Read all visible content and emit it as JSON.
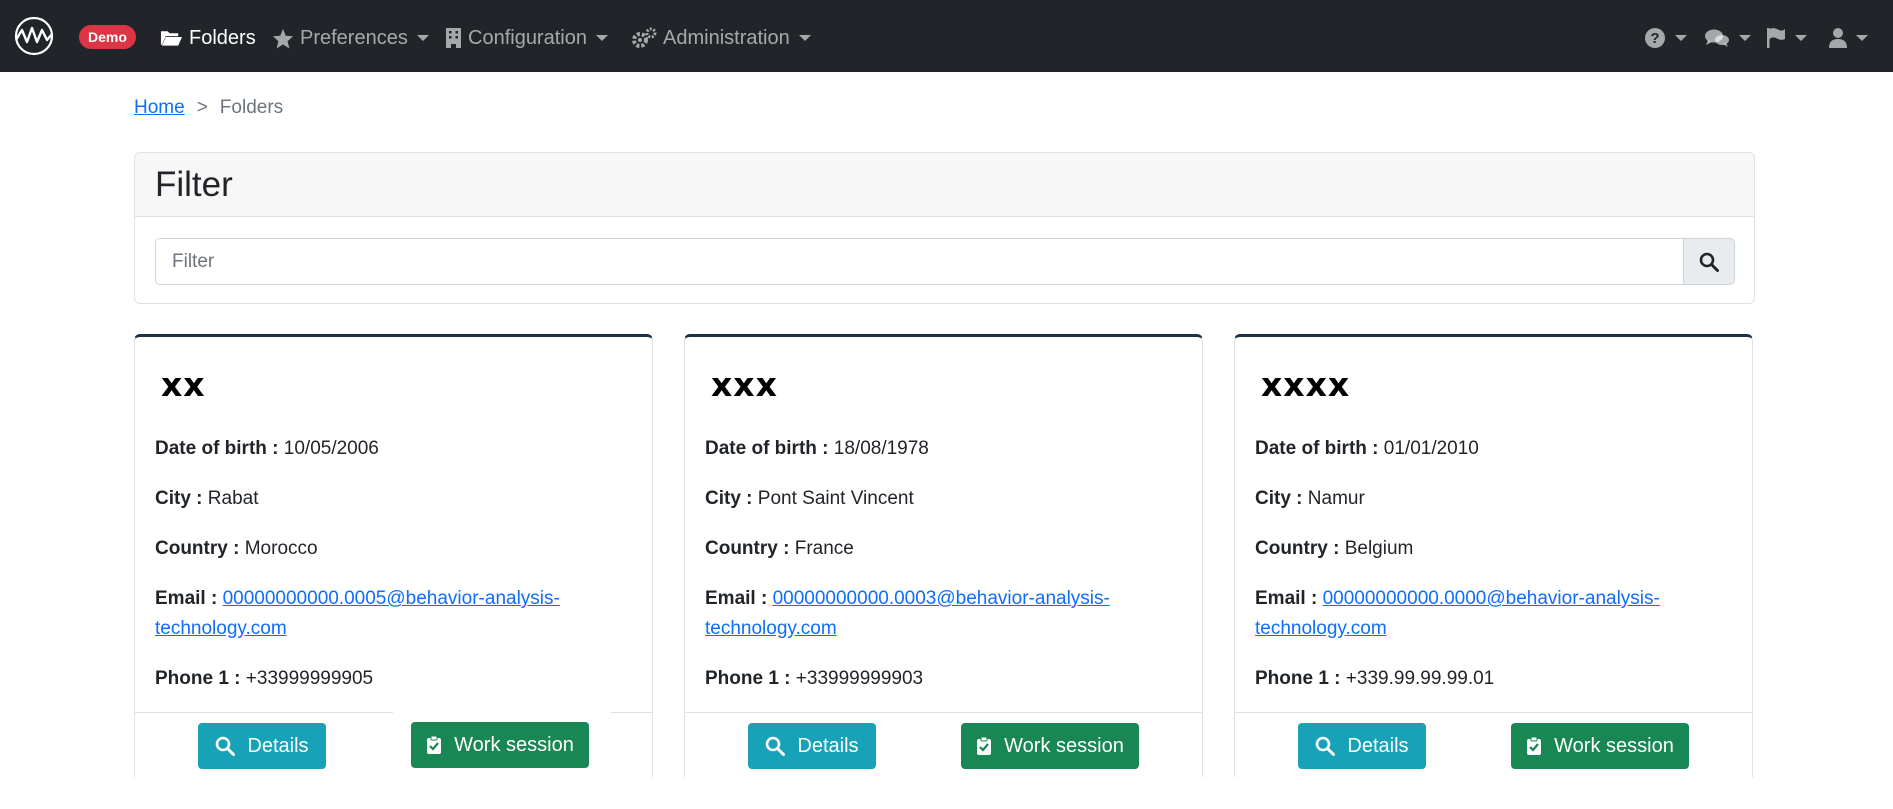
{
  "navbar": {
    "badge": "Demo",
    "items": [
      {
        "label": "Folders",
        "icon": "folder-open-icon"
      },
      {
        "label": "Preferences",
        "icon": "star-icon"
      },
      {
        "label": "Configuration",
        "icon": "building-icon"
      },
      {
        "label": "Administration",
        "icon": "gears-icon"
      }
    ],
    "right_icons": [
      "question-circle-icon",
      "comments-icon",
      "flag-icon",
      "user-icon"
    ]
  },
  "breadcrumb": {
    "home": "Home",
    "separator": ">",
    "current": "Folders"
  },
  "filter": {
    "title": "Filter",
    "placeholder": "Filter"
  },
  "labels": {
    "dob": "Date of birth :",
    "city": "City :",
    "country": "Country :",
    "email": "Email :",
    "phone": "Phone 1 :",
    "details": "Details",
    "work_session": "Work session"
  },
  "folders": [
    {
      "name": "xx",
      "dob": "10/05/2006",
      "city": "Rabat",
      "country": "Morocco",
      "email_line1": "00000000000.0005@behavior-analysis-",
      "email_line2": "technology.com",
      "phone": "+33999999905"
    },
    {
      "name": "xxx",
      "dob": "18/08/1978",
      "city": "Pont Saint Vincent",
      "country": "France",
      "email_line1": "00000000000.0003@behavior-analysis-",
      "email_line2": "technology.com",
      "phone": "+33999999903"
    },
    {
      "name": "xxxx",
      "dob": "01/01/2010",
      "city": "Namur",
      "country": "Belgium",
      "email_line1": "00000000000.0000@behavior-analysis-",
      "email_line2": "technology.com",
      "phone": "+339.99.99.99.01"
    }
  ],
  "colors": {
    "navbar": "#212529",
    "badge": "#dc3545",
    "details_button": "#17a2b8",
    "work_session_button": "#198754",
    "link": "#0d6efd",
    "card_top_border": "#1c3147"
  }
}
